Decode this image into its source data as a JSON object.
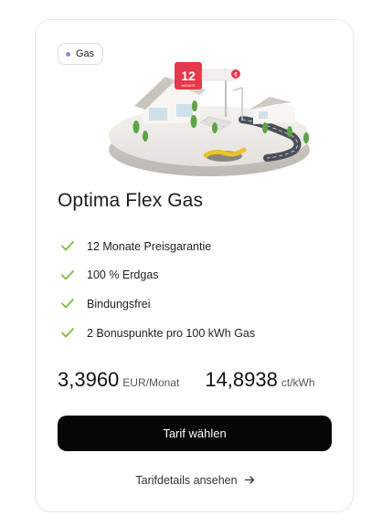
{
  "card": {
    "badge": "Gas",
    "illustration": {
      "sign_number": "12",
      "sign_caption": "MONATE",
      "sign_tag": "€"
    },
    "title": "Optima Flex Gas",
    "features": [
      "12 Monate Preisgarantie",
      "100 % Erdgas",
      "Bindungsfrei",
      "2 Bonuspunkte pro 100 kWh Gas"
    ],
    "prices": [
      {
        "value": "3,3960",
        "unit": "EUR/Monat"
      },
      {
        "value": "14,8938",
        "unit": "ct/kWh"
      }
    ],
    "cta_label": "Tarif wählen",
    "details_label": "Tarifdetails ansehen"
  },
  "colors": {
    "check": "#7bbf3a",
    "cta_bg": "#050505",
    "badge_dot": "#8c8cd6",
    "sign_red": "#e5384a"
  },
  "icons": {
    "feature": "check-icon",
    "details": "arrow-right-icon",
    "badge": "dot-icon"
  }
}
